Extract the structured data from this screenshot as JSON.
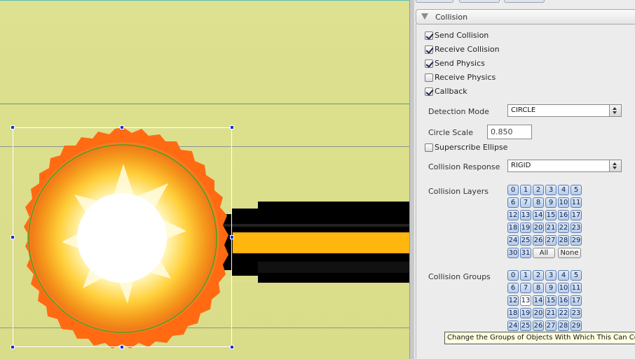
{
  "section": {
    "title": "Collision"
  },
  "checkboxes": [
    {
      "label": "Send Collision",
      "checked": true
    },
    {
      "label": "Receive Collision",
      "checked": true
    },
    {
      "label": "Send Physics",
      "checked": true
    },
    {
      "label": "Receive Physics",
      "checked": false
    },
    {
      "label": "Callback",
      "checked": true
    }
  ],
  "detection_mode": {
    "label": "Detection Mode",
    "value": "CIRCLE"
  },
  "circle_scale": {
    "label": "Circle Scale",
    "value": "0.850"
  },
  "superscribe": {
    "label": "Superscribe Ellipse",
    "checked": false
  },
  "collision_response": {
    "label": "Collision Response",
    "value": "RIGID"
  },
  "collision_layers": {
    "label": "Collision Layers",
    "buttons": [
      "0",
      "1",
      "2",
      "3",
      "4",
      "5",
      "6",
      "7",
      "8",
      "9",
      "10",
      "11",
      "12",
      "13",
      "14",
      "15",
      "16",
      "17",
      "18",
      "19",
      "20",
      "21",
      "22",
      "23",
      "24",
      "25",
      "26",
      "27",
      "28",
      "29",
      "30",
      "31"
    ],
    "all_label": "All",
    "none_label": "None"
  },
  "collision_groups": {
    "label": "Collision Groups",
    "buttons": [
      "0",
      "1",
      "2",
      "3",
      "4",
      "5",
      "6",
      "7",
      "8",
      "9",
      "10",
      "11",
      "12",
      "13",
      "14",
      "15",
      "16",
      "17",
      "18",
      "19",
      "20",
      "21",
      "22",
      "23",
      "24",
      "25",
      "26",
      "27",
      "28",
      "29"
    ]
  },
  "tooltip": "Change the Groups of Objects With Which This Can Collide",
  "colors": {
    "canvas_bg": "#dce08d",
    "selection_handle": "#1a2fd6",
    "collision_circle": "#22aa22",
    "button_blue": "#b7cbe8"
  }
}
